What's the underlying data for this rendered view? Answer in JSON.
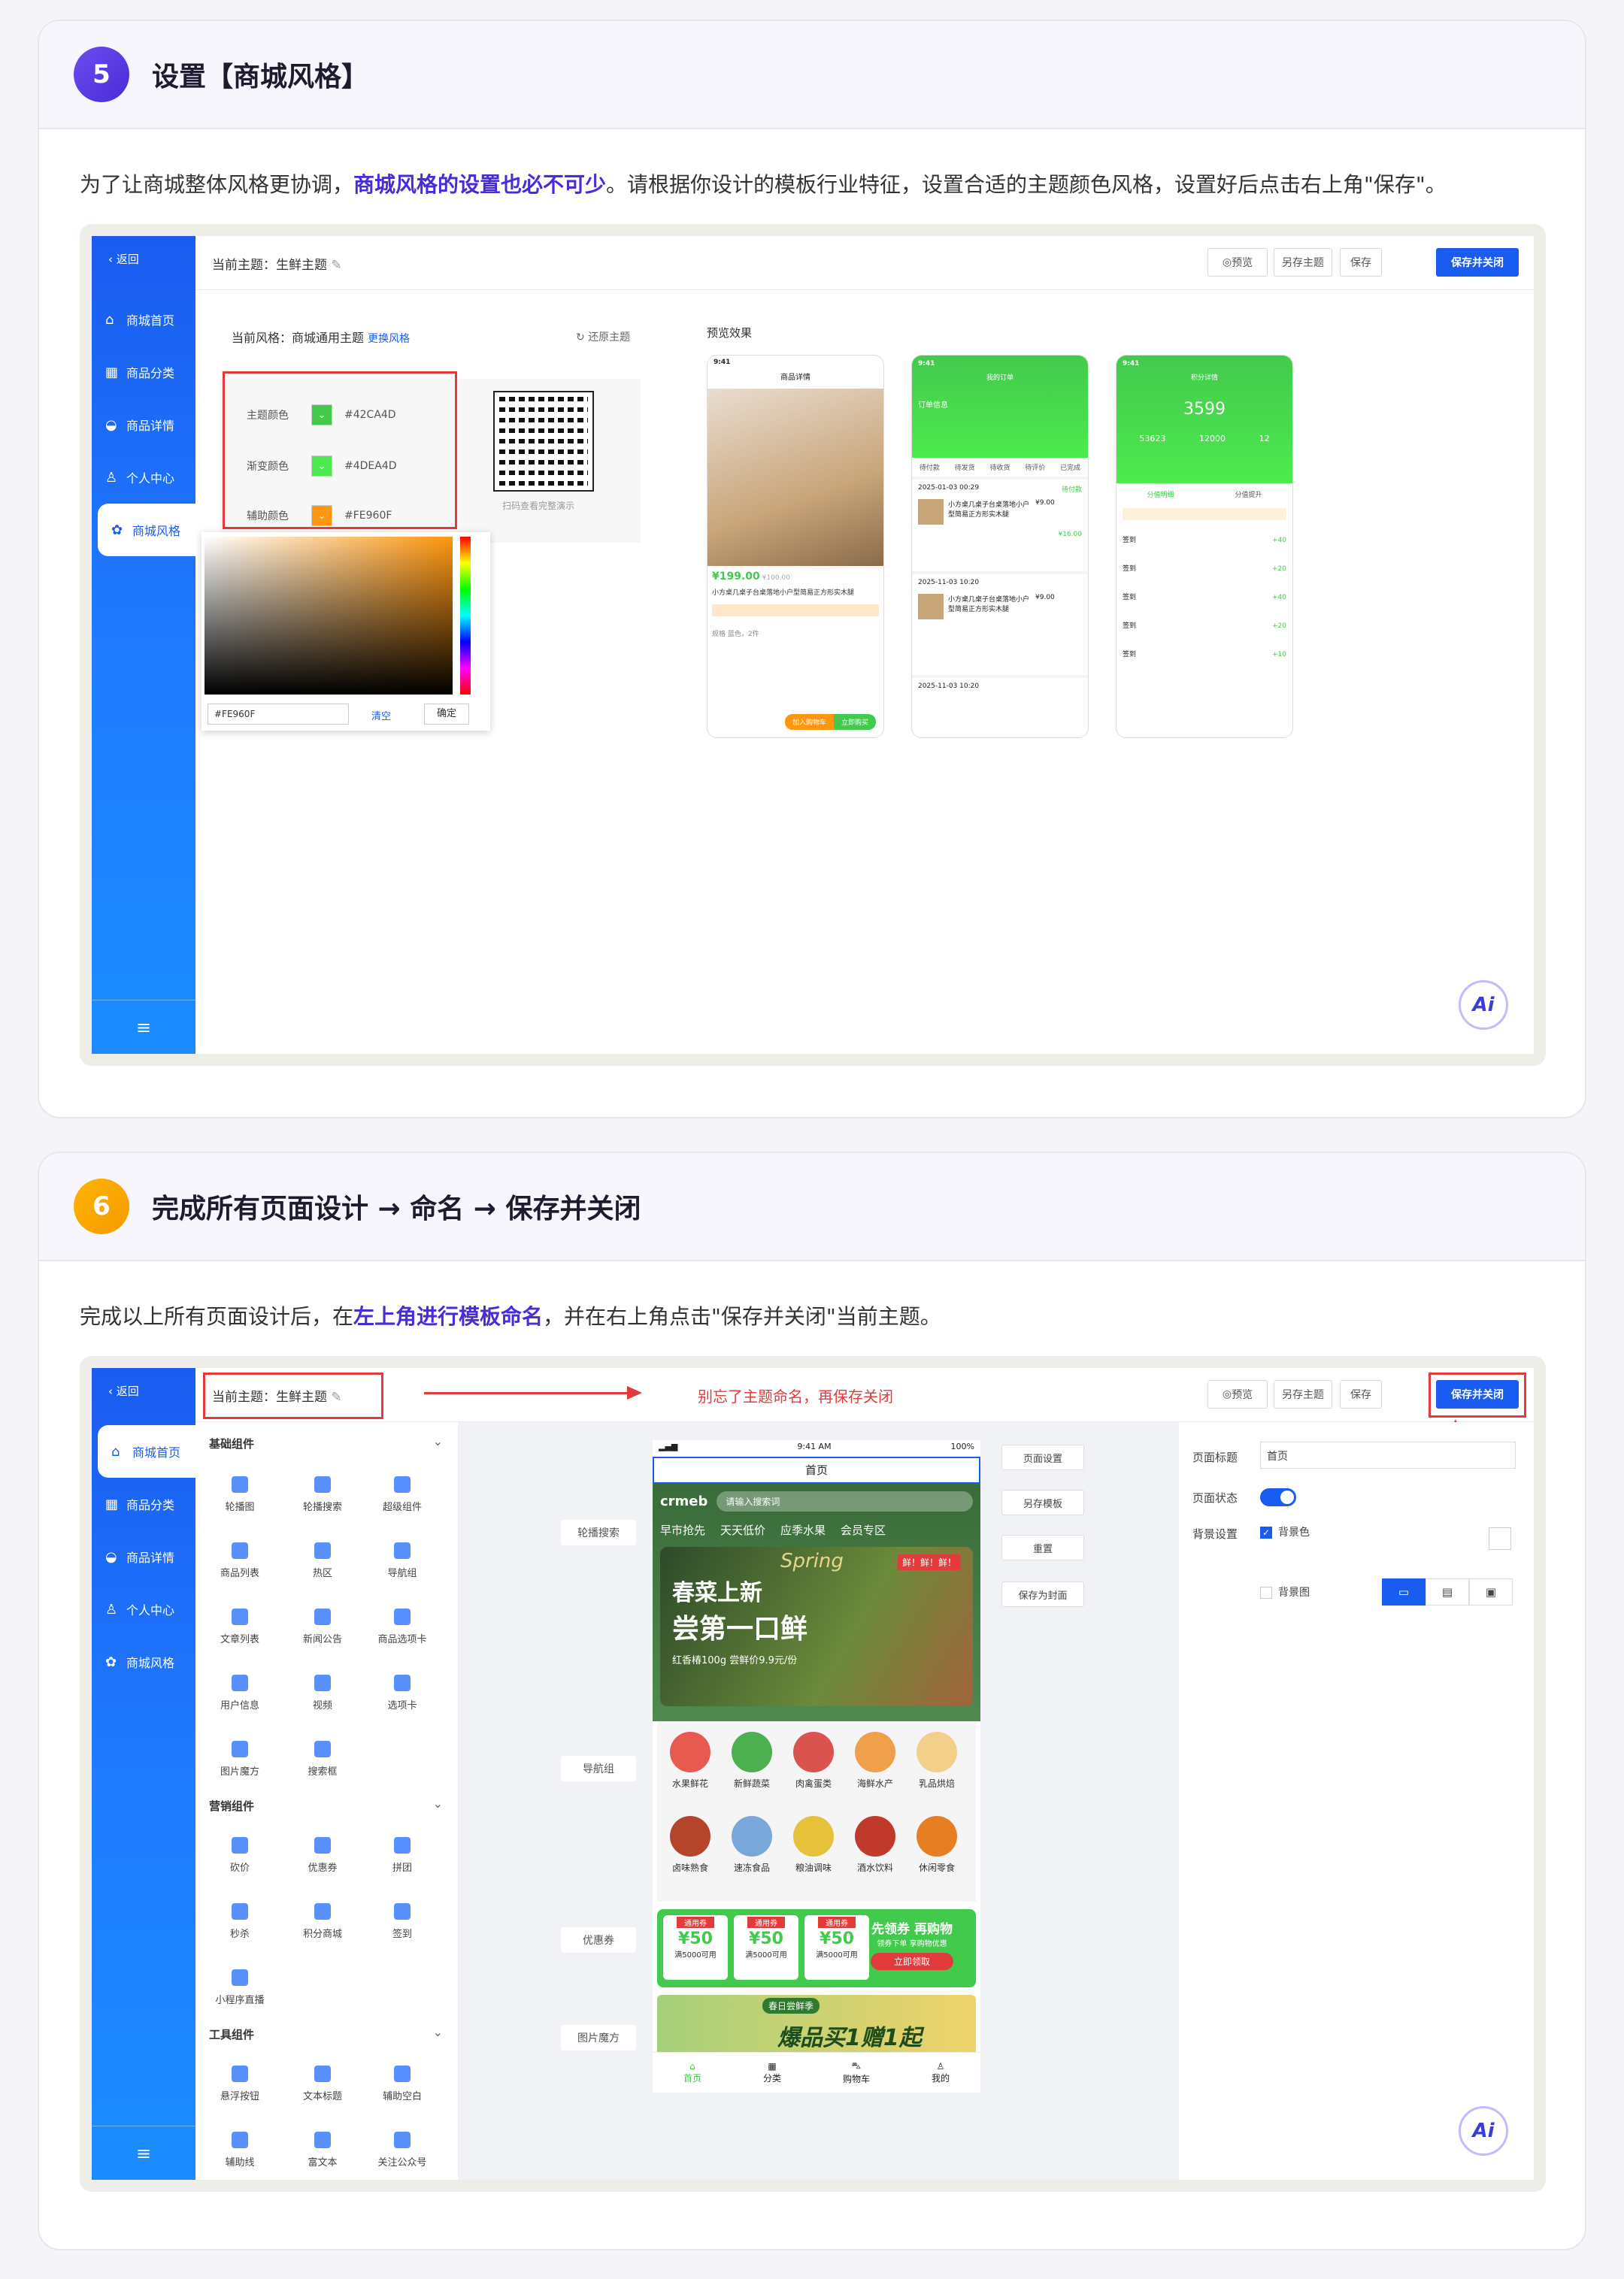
{
  "step5": {
    "number": "5",
    "title": "设置【商城风格】",
    "desc_pre": "为了让商城整体风格更协调，",
    "desc_bold": "商城风格的设置也必不可少",
    "desc_post": "。请根据你设计的模板行业特征，设置合适的主题颜色风格，设置好后点击右上角\"保存\"。",
    "ui": {
      "back": "返回",
      "current_theme": "当前主题：生鲜主题",
      "buttons": {
        "preview": "预览",
        "save_as": "另存主题",
        "save": "保存",
        "save_close": "保存并关闭"
      },
      "style_label": "当前风格：商城通用主题",
      "change_style": "更换风格",
      "restore": "还原主题",
      "colors": [
        {
          "label": "主题颜色",
          "value": "#42CA4D",
          "swatch": "#42CA4D"
        },
        {
          "label": "渐变颜色",
          "value": "#4DEA4D",
          "swatch": "#4DEA4D"
        },
        {
          "label": "辅助颜色",
          "value": "#FE960F",
          "swatch": "#FE960F"
        }
      ],
      "picker_value": "#FE960F",
      "picker_clear": "清空",
      "picker_ok": "确定",
      "qr_caption": "扫码查看完整演示",
      "preview_title": "预览效果",
      "phone1": {
        "time": "9:41",
        "title": "商品详情",
        "price": "¥199.00",
        "old_price": "¥100.00",
        "name": "小方桌几桌子台桌落地小户型简易正方形实木腿",
        "spec_label": "规格",
        "spec": "蓝色，2件",
        "cart": "加入购物车",
        "buy": "立即购买"
      },
      "phone2": {
        "time": "9:41",
        "title": "我的订单",
        "header": "订单信息",
        "tabs": [
          "待付款",
          "待发货",
          "待收货",
          "待评价",
          "已完成"
        ],
        "date1": "2025-01-03 00:29",
        "date2": "2025-11-03 10:20",
        "date3": "2025-11-03 10:20",
        "status": "待付款",
        "item": "小方桌几桌子台桌落地小户型简易正方形实木腿",
        "price": "¥9.00",
        "total": "¥16.00"
      },
      "phone3": {
        "time": "9:41",
        "title": "积分详情",
        "points": "3599",
        "stats": [
          "53623",
          "12000",
          "12"
        ],
        "tab1": "分值明细",
        "tab2": "分值提升",
        "rows": [
          {
            "label": "签到",
            "val": "+40"
          },
          {
            "label": "签到",
            "val": "+20"
          },
          {
            "label": "签到",
            "val": "+40"
          },
          {
            "label": "签到",
            "val": "+20"
          },
          {
            "label": "签到",
            "val": "+10"
          }
        ]
      },
      "nav": [
        {
          "label": "商城首页",
          "icon": "⌂"
        },
        {
          "label": "商品分类",
          "icon": "▦"
        },
        {
          "label": "商品详情",
          "icon": "◒"
        },
        {
          "label": "个人中心",
          "icon": "♙"
        },
        {
          "label": "商城风格",
          "icon": "✿"
        }
      ],
      "ai": "Ai"
    }
  },
  "step6": {
    "number": "6",
    "title": "完成所有页面设计 → 命名 → 保存并关闭",
    "desc_pre": "完成以上所有页面设计后，在",
    "desc_bold": "左上角进行模板命名",
    "desc_post": "，并在右上角点击\"保存并关闭\"当前主题。",
    "annotation": "别忘了主题命名，再保存关闭",
    "ui": {
      "back": "返回",
      "current_theme": "当前主题：生鲜主题",
      "buttons": {
        "preview": "预览",
        "save_as": "另存主题",
        "save": "保存",
        "save_close": "保存并关闭"
      },
      "groups": [
        {
          "title": "基础组件",
          "items": [
            "轮播图",
            "轮播搜索",
            "超级组件",
            "商品列表",
            "热区",
            "导航组",
            "文章列表",
            "新闻公告",
            "商品选项卡",
            "用户信息",
            "视频",
            "选项卡",
            "图片魔方",
            "搜索框"
          ]
        },
        {
          "title": "营销组件",
          "items": [
            "砍价",
            "优惠券",
            "拼团",
            "秒杀",
            "积分商城",
            "签到",
            "小程序直播"
          ]
        },
        {
          "title": "工具组件",
          "items": [
            "悬浮按钮",
            "文本标题",
            "辅助空白",
            "辅助线",
            "富文本",
            "关注公众号"
          ]
        }
      ],
      "side_tags": [
        "轮播搜索",
        "导航组",
        "优惠券",
        "图片魔方"
      ],
      "right_actions": [
        "页面设置",
        "另存模板",
        "重置",
        "保存为封面"
      ],
      "phone": {
        "time": "9:41 AM",
        "battery": "100%",
        "title": "首页",
        "logo": "crmeb",
        "search_placeholder": "请输入搜索词",
        "tabs": [
          "早市抢先",
          "天天低价",
          "应季水果",
          "会员专区"
        ],
        "banner_title": "春菜上新",
        "banner_sub": "尝第一口鲜",
        "banner_script": "Spring",
        "banner_badge": "鲜！鲜！鲜！",
        "banner_price": "红香椿100g 尝鲜价9.9元/份",
        "categories": [
          {
            "label": "水果鲜花",
            "color": "#e85a4f"
          },
          {
            "label": "新鲜蔬菜",
            "color": "#4caf50"
          },
          {
            "label": "肉禽蛋类",
            "color": "#d9534f"
          },
          {
            "label": "海鲜水产",
            "color": "#f0a04b"
          },
          {
            "label": "乳品烘焙",
            "color": "#f2d08a"
          },
          {
            "label": "卤味熟食",
            "color": "#b5452a"
          },
          {
            "label": "速冻食品",
            "color": "#7aa7d9"
          },
          {
            "label": "粮油调味",
            "color": "#e6c13a"
          },
          {
            "label": "酒水饮料",
            "color": "#c0392b"
          },
          {
            "label": "休闲零食",
            "color": "#e67e22"
          }
        ],
        "coupons": [
          {
            "tag": "通用券",
            "value": "¥50",
            "cond": "满5000可用"
          },
          {
            "tag": "通用券",
            "value": "¥50",
            "cond": "满5000可用"
          },
          {
            "tag": "通用券",
            "value": "¥50",
            "cond": "满5000可用"
          }
        ],
        "coupon_title": "先领券 再购物",
        "coupon_sub": "领券下单 享购物优惠",
        "coupon_btn": "立即领取",
        "promo_badge": "春日尝鲜季",
        "promo_title": "爆品买1赠1起",
        "tabbar": [
          "首页",
          "分类",
          "购物车",
          "我的"
        ]
      },
      "props": {
        "title_label": "页面标题",
        "title_value": "首页",
        "status_label": "页面状态",
        "bg_label": "背景设置",
        "bg_color": "背景色",
        "bg_image": "背景图"
      },
      "nav": [
        {
          "label": "商城首页",
          "icon": "⌂"
        },
        {
          "label": "商品分类",
          "icon": "▦"
        },
        {
          "label": "商品详情",
          "icon": "◒"
        },
        {
          "label": "个人中心",
          "icon": "♙"
        },
        {
          "label": "商城风格",
          "icon": "✿"
        }
      ],
      "ai": "Ai"
    }
  },
  "colors": {
    "accent": "#1a5cf0",
    "step5": "#5b3fe0",
    "step6": "#f5a300",
    "green": "#42CA4D",
    "red": "#e23b3b"
  }
}
